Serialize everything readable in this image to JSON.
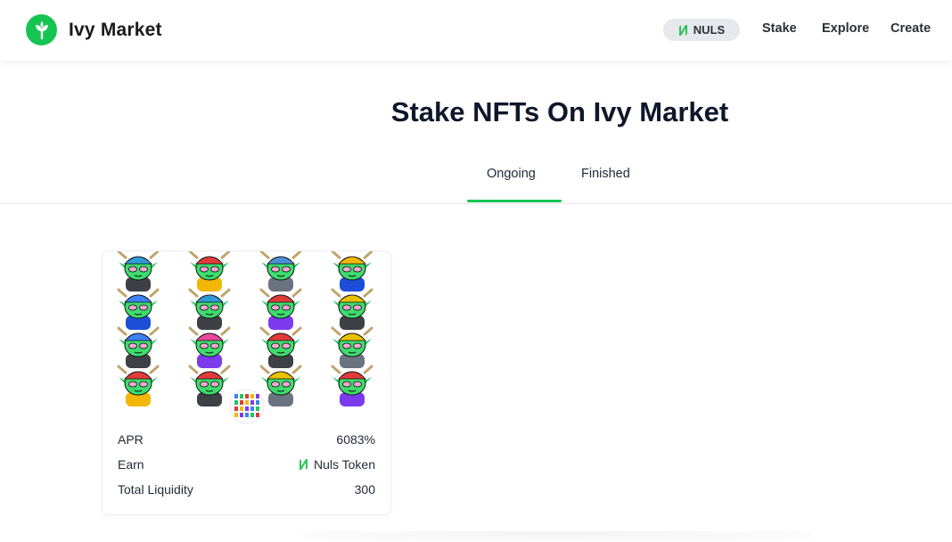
{
  "header": {
    "brand": "Ivy Market",
    "network_label": "NULS",
    "nav": [
      {
        "label": "Stake"
      },
      {
        "label": "Explore"
      },
      {
        "label": "Create"
      }
    ]
  },
  "main": {
    "title": "Stake NFTs On Ivy Market",
    "tabs": [
      {
        "label": "Ongoing",
        "active": true
      },
      {
        "label": "Finished",
        "active": false
      }
    ]
  },
  "pool_card": {
    "image": "nft-collection-grid",
    "rows": [
      {
        "label": "APR",
        "value": "6083%"
      },
      {
        "label": "Earn",
        "value": "Nuls Token",
        "icon": "nuls-icon"
      },
      {
        "label": "Total Liquidity",
        "value": "300"
      }
    ]
  },
  "colors": {
    "accent": "#16c452",
    "pill_bg": "#e6e8ec"
  }
}
